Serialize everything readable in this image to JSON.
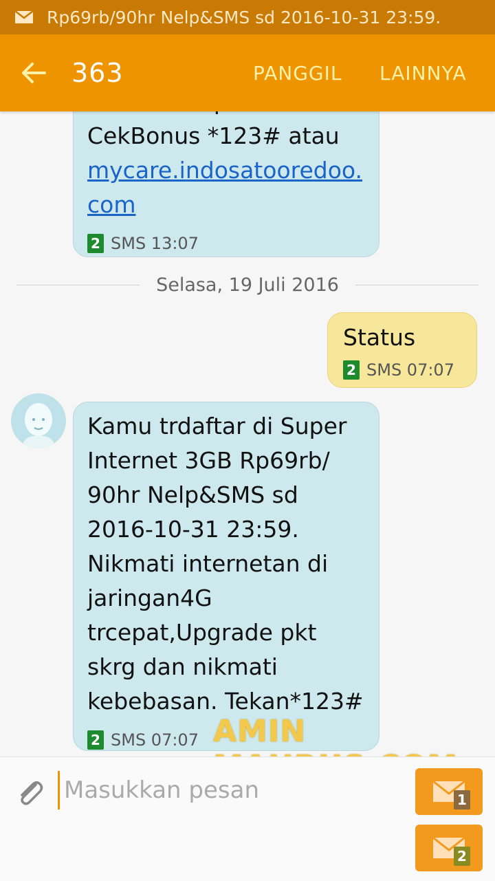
{
  "status_bar": {
    "ticker": "Rp69rb/90hr Nelp&SMS sd 2016-10-31 23:59."
  },
  "app_bar": {
    "title": "363",
    "call_label": "PANGGIL",
    "more_label": "LAINNYA"
  },
  "messages": [
    {
      "direction": "incoming",
      "text_partial_top": "masa aktif paket.",
      "text": "CekBonus *123# atau",
      "link": "mycare.indosatooredoo.\ncom",
      "sim": "2",
      "meta": "SMS 13:07"
    },
    {
      "direction": "outgoing",
      "text": "Status",
      "sim": "2",
      "meta": "SMS 07:07"
    },
    {
      "direction": "incoming",
      "text": "Kamu trdaftar di Super\nInternet 3GB Rp69rb/\n90hr Nelp&SMS sd\n2016-10-31 23:59.\nNikmati internetan di\njaringan4G\ntrcepat,Upgrade pkt\nskrg dan nikmati\nkebebasan. Tekan*123#",
      "sim": "2",
      "meta": "SMS 07:07"
    }
  ],
  "date_separator": "Selasa, 19 Juli 2016",
  "watermark": "AMIN MAHRUS.COM",
  "composer": {
    "placeholder": "Masukkan pesan",
    "send1_badge": "1",
    "send2_badge": "2"
  },
  "colors": {
    "app_bar": "#ee9400",
    "status_bar": "#c87a05",
    "incoming_bubble": "#cde9ee",
    "outgoing_bubble": "#f7e79b",
    "link": "#1a64c8",
    "sim_badge": "#1e8a2e"
  },
  "icons": {
    "status": "mail-icon",
    "back": "arrow-left-icon",
    "attach": "paperclip-icon",
    "send": "envelope-icon"
  }
}
